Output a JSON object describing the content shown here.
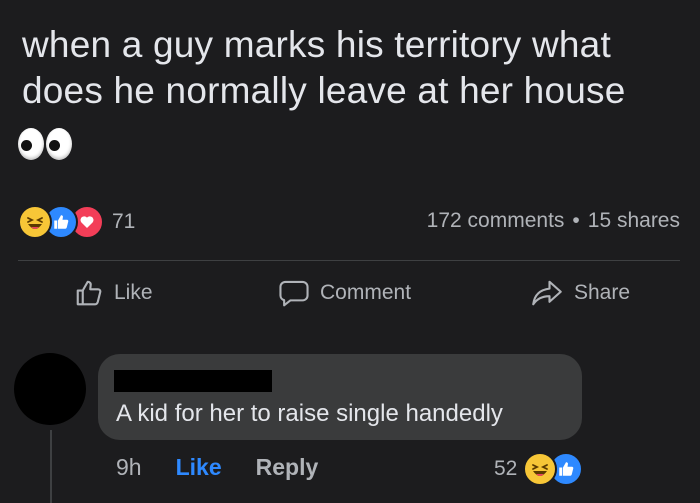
{
  "post": {
    "text_line1": "when a guy marks his territory what",
    "text_line2": "does he normally leave at her house",
    "emoji": "eyes-emoji",
    "reaction_icons": [
      "haha-reaction-icon",
      "like-reaction-icon",
      "love-reaction-icon"
    ],
    "reaction_count": "71",
    "comments_count": "172 comments",
    "separator": "•",
    "shares_count": "15 shares"
  },
  "actions": {
    "like_label": "Like",
    "comment_label": "Comment",
    "share_label": "Share"
  },
  "comment": {
    "text": "A kid for her to raise single handedly",
    "time": "9h",
    "like_label": "Like",
    "reply_label": "Reply",
    "reaction_count": "52",
    "reaction_icons": [
      "haha-reaction-icon",
      "like-reaction-icon"
    ]
  },
  "colors": {
    "background": "#1c1c1e",
    "text_primary": "#e4e6eb",
    "text_secondary": "#b0b3b8",
    "bubble": "#3a3b3c",
    "accent_blue": "#2e89ff",
    "love_red": "#f33e58",
    "haha_yellow": "#f7c637"
  }
}
